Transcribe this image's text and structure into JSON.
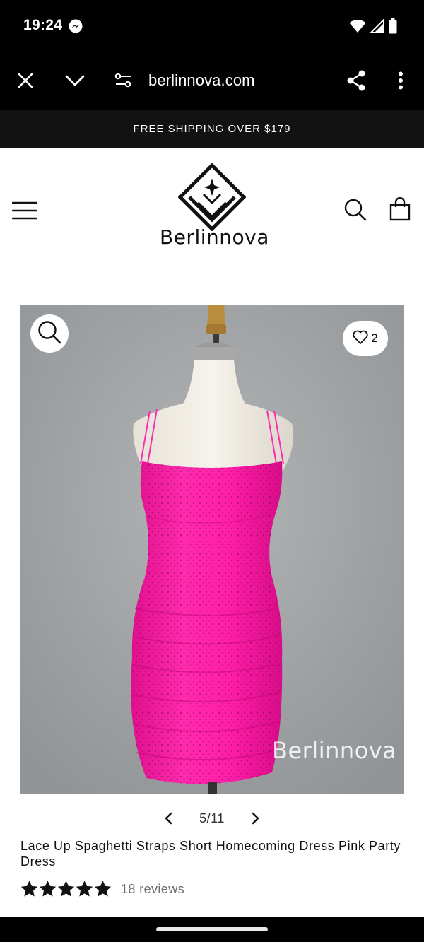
{
  "status_bar": {
    "time": "19:24",
    "icons": [
      "messenger-icon",
      "wifi-icon",
      "signal-icon",
      "battery-icon"
    ]
  },
  "browser": {
    "url": "berlinnova.com",
    "icons": [
      "close-icon",
      "chevron-down-icon",
      "site-settings-icon",
      "share-icon",
      "more-vert-icon"
    ]
  },
  "announcement": {
    "text": "FREE SHIPPING OVER $179"
  },
  "header": {
    "brand": "Berlinnova",
    "icons": [
      "menu-icon",
      "search-icon",
      "bag-icon"
    ]
  },
  "product": {
    "wishlist_count": "2",
    "watermark": "Berlinnova",
    "pager": "5/11",
    "title": "Lace Up Spaghetti Straps Short Homecoming Dress Pink Party Dress",
    "rating": 5,
    "rating_max": 5,
    "reviews": "18 reviews"
  },
  "colors": {
    "dress": "#ff1ea8",
    "background_gray": "#9fa2a4",
    "header_black": "#000000",
    "announce_bg": "#121212"
  }
}
